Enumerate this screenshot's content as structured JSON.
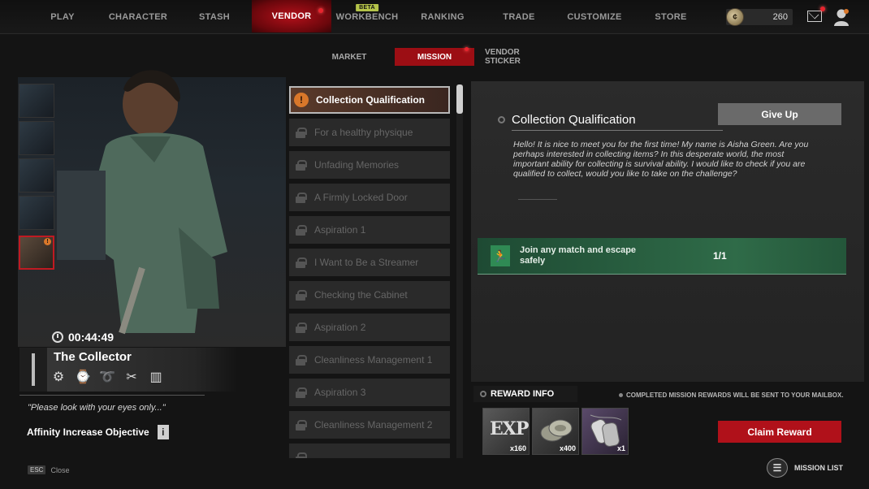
{
  "topnav": {
    "items": [
      {
        "label": "PLAY"
      },
      {
        "label": "CHARACTER"
      },
      {
        "label": "STASH"
      },
      {
        "label": "VENDOR"
      },
      {
        "label": "WORKBENCH",
        "badge": "BETA"
      },
      {
        "label": "RANKING"
      },
      {
        "label": "TRADE"
      },
      {
        "label": "CUSTOMIZE"
      },
      {
        "label": "STORE"
      }
    ],
    "active": "VENDOR",
    "currency": "260",
    "icons": {
      "currency": "coin-icon",
      "mail": "mail-icon",
      "profile": "profile-icon"
    }
  },
  "subnav": {
    "items": [
      {
        "label": "MARKET"
      },
      {
        "label": "MISSION"
      },
      {
        "label": "VENDOR STICKER"
      }
    ],
    "active": "MISSION"
  },
  "character": {
    "timer": "00:44:49",
    "name": "The Collector",
    "skills": [
      "gear-icon",
      "watch-icon",
      "ribbon-icon",
      "tools-icon",
      "books-icon"
    ],
    "quote": "\"Please look with your eyes only...\"",
    "affinity_label": "Affinity Increase Objective",
    "esc_key": "ESC",
    "esc_label": "Close"
  },
  "missions": [
    {
      "label": "Collection Qualification",
      "state": "active"
    },
    {
      "label": "For a healthy physique",
      "state": "locked"
    },
    {
      "label": "Unfading Memories",
      "state": "locked"
    },
    {
      "label": "A Firmly Locked Door",
      "state": "locked"
    },
    {
      "label": "Aspiration 1",
      "state": "locked"
    },
    {
      "label": "I Want to Be a Streamer",
      "state": "locked"
    },
    {
      "label": "Checking the Cabinet",
      "state": "locked"
    },
    {
      "label": "Aspiration 2",
      "state": "locked"
    },
    {
      "label": "Cleanliness Management 1",
      "state": "locked"
    },
    {
      "label": "Aspiration 3",
      "state": "locked"
    },
    {
      "label": "Cleanliness Management 2",
      "state": "locked"
    }
  ],
  "detail": {
    "title": "Collection Qualification",
    "give_up": "Give Up",
    "description": "Hello! It is nice to meet you for the first time! My name is Aisha Green. Are you perhaps interested in collecting items? In this desperate world, the most important ability for collecting is survival ability. I would like to check if you are qualified to collect, would you like to take on the challenge?",
    "objective": {
      "text": "Join any match and escape safely",
      "progress": "1/1"
    }
  },
  "rewards": {
    "header": "REWARD INFO",
    "note": "COMPLETED MISSION REWARDS WILL BE SENT TO YOUR MAILBOX.",
    "items": [
      {
        "icon": "exp-icon",
        "label": "EXP",
        "qty": "x160"
      },
      {
        "icon": "coins-icon",
        "qty": "x400"
      },
      {
        "icon": "dog-tag-icon",
        "qty": "x1"
      }
    ],
    "claim": "Claim Reward",
    "mission_list": "MISSION LIST"
  }
}
